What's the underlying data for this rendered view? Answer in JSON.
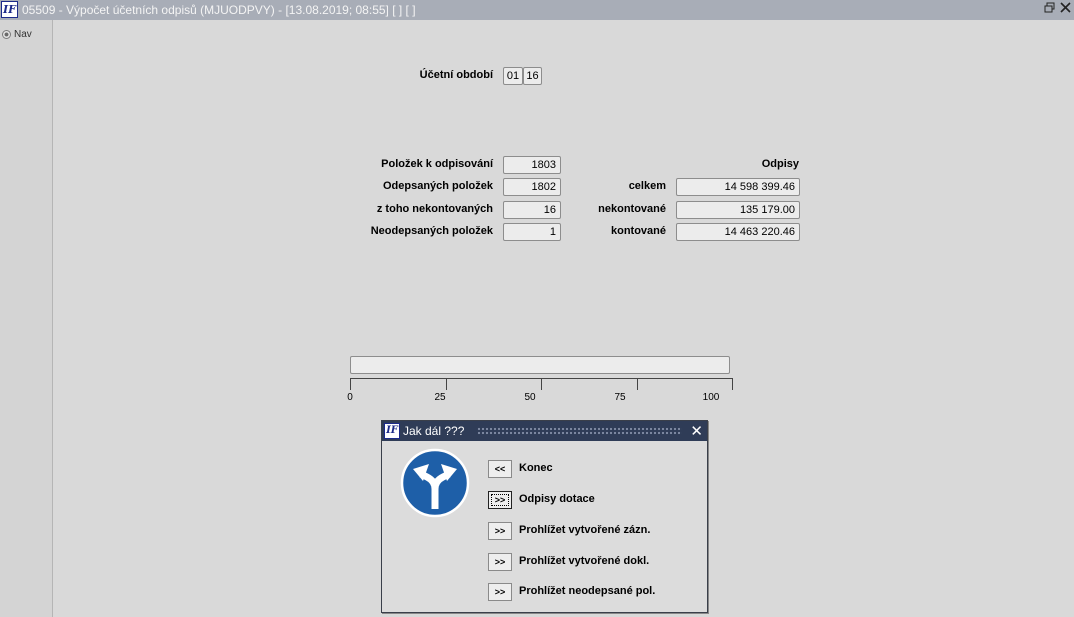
{
  "window": {
    "title": "05509 - Výpočet účetních odpisů (MJUODPVY) - [13.08.2019; 08:55]  [ ]  [ ]",
    "logo_text": "IF",
    "restore_icon": "restore-icon",
    "close_icon": "close-icon"
  },
  "nav": {
    "tab_label": "Nav"
  },
  "period": {
    "label": "Účetní období",
    "month": "01",
    "year": "16"
  },
  "stats": {
    "items_to_depreciate_label": "Položek k odpisování",
    "items_to_depreciate": "1803",
    "depreciated_items_label": "Odepsaných položek",
    "depreciated_items": "1802",
    "uncontrolled_label": "z toho nekontovaných",
    "uncontrolled": "16",
    "not_depreciated_label": "Neodepsaných položek",
    "not_depreciated": "1"
  },
  "depreciation": {
    "heading": "Odpisy",
    "total_label": "celkem",
    "total": "14 598 399.46",
    "uncontrolled_label": "nekontované",
    "uncontrolled": "135 179.00",
    "controlled_label": "kontované",
    "controlled": "14 463 220.46"
  },
  "progress": {
    "value": 0,
    "scale_labels": [
      "0",
      "25",
      "50",
      "75",
      "100"
    ]
  },
  "dialog": {
    "logo_text": "IF",
    "title": "Jak dál ???",
    "close_glyph": "✕",
    "sign_icon": "fork-direction-sign-icon",
    "actions": [
      {
        "button": "<<",
        "label": "Konec"
      },
      {
        "button": ">>",
        "label": "Odpisy dotace"
      },
      {
        "button": ">>",
        "label": "Prohlížet vytvořené zázn."
      },
      {
        "button": ">>",
        "label": "Prohlížet vytvořené dokl."
      },
      {
        "button": ">>",
        "label": "Prohlížet neodepsané pol."
      }
    ]
  },
  "colors": {
    "title_bar": "#a8adb7",
    "dialog_title_bar": "#2f3c57",
    "sign_blue": "#1e5fa8"
  }
}
